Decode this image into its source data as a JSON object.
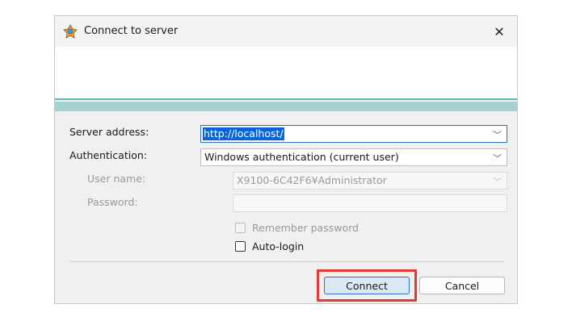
{
  "dialog": {
    "title": "Connect to server",
    "close_glyph": "✕",
    "app_icon": "connect-server-icon"
  },
  "form": {
    "server_address_label": "Server address:",
    "server_address_value": "http://localhost/",
    "authentication_label": "Authentication:",
    "authentication_value": "Windows authentication (current user)",
    "user_name_label": "User name:",
    "user_name_value": "X9100-6C42F6¥Administrator",
    "password_label": "Password:",
    "password_value": "",
    "remember_password_label": "Remember password",
    "remember_password_checked": false,
    "auto_login_label": "Auto-login",
    "auto_login_checked": false
  },
  "buttons": {
    "connect_label": "Connect",
    "cancel_label": "Cancel"
  },
  "colors": {
    "accent_blue": "#0a64d6",
    "banner_teal": "#a6d3d1",
    "highlight_red": "#e53935"
  }
}
